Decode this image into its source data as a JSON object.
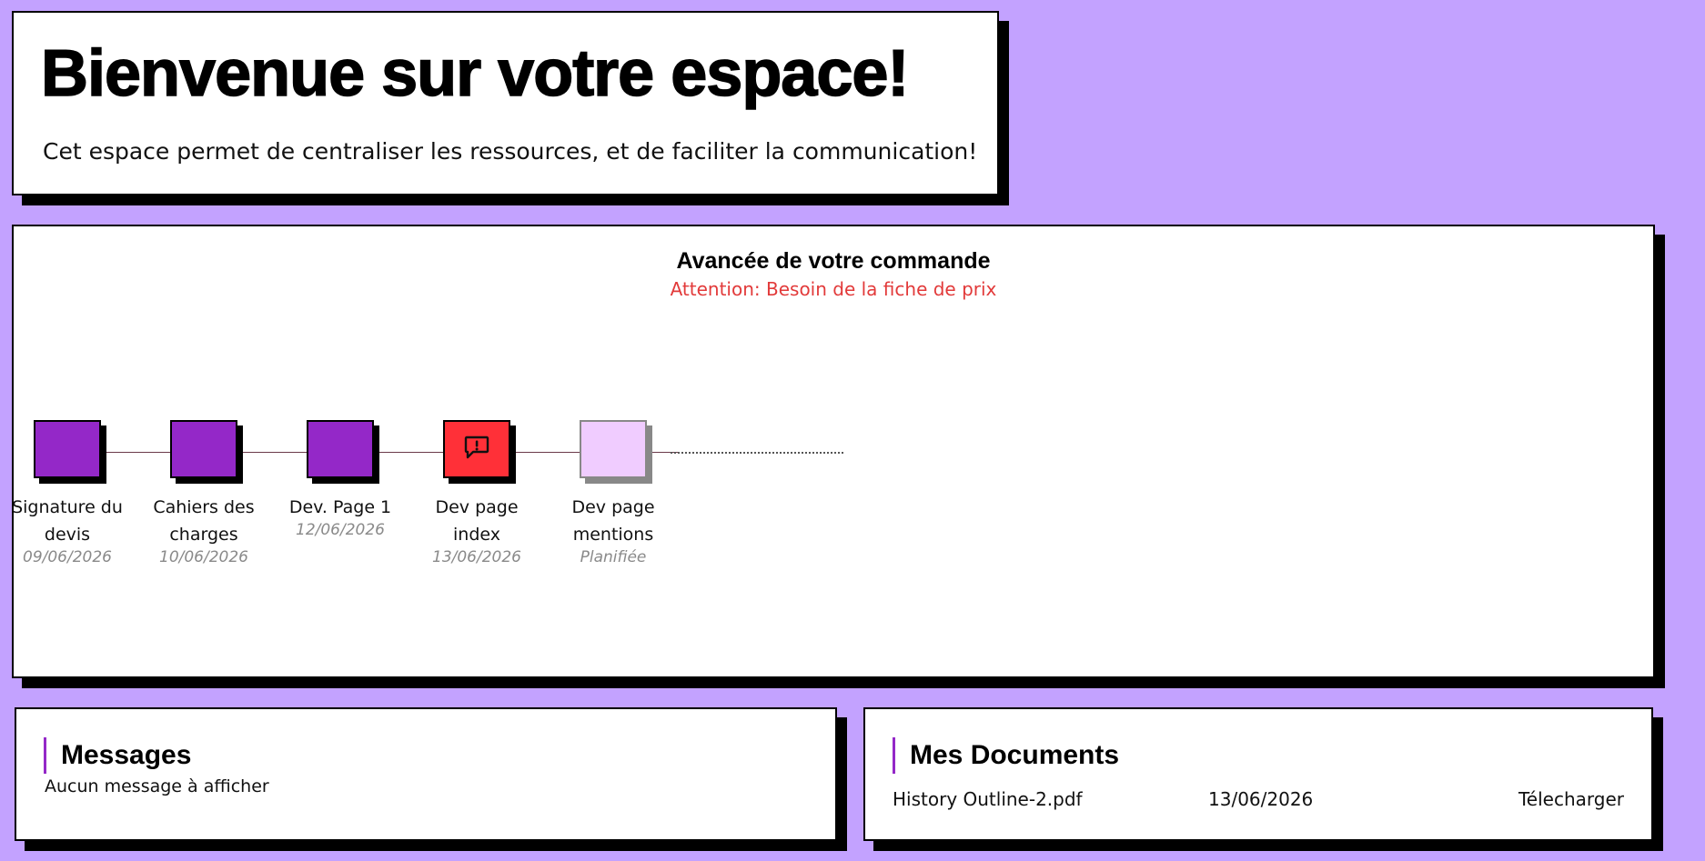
{
  "welcome": {
    "title": "Bienvenue sur votre espace!",
    "subtitle": "Cet espace permet de centraliser les ressources, et de faciliter la communication!"
  },
  "progress": {
    "title": "Avancée de votre commande",
    "warning": "Attention: Besoin de la fiche de prix",
    "steps": [
      {
        "label": "Signature du devis",
        "date": "09/06/2026",
        "status": "done"
      },
      {
        "label": "Cahiers des charges",
        "date": "10/06/2026",
        "status": "done"
      },
      {
        "label": "Dev. Page 1",
        "date": "12/06/2026",
        "status": "done"
      },
      {
        "label": "Dev page index",
        "date": "13/06/2026",
        "status": "alert",
        "icon": "alert-message-icon"
      },
      {
        "label": "Dev page mentions",
        "date": "Planifiée",
        "status": "planned"
      }
    ]
  },
  "messages": {
    "title": "Messages",
    "empty_text": "Aucun message à afficher"
  },
  "documents": {
    "title": "Mes Documents",
    "items": [
      {
        "name": "History Outline-2.pdf",
        "date": "13/06/2026",
        "action": "Télecharger"
      }
    ]
  },
  "colors": {
    "background": "#c3a2ff",
    "step_done": "#9428c8",
    "step_alert": "#ff3038",
    "step_planned": "#f0ccff",
    "warning_text": "#e23a3a",
    "accent_bar": "#9428c8"
  }
}
